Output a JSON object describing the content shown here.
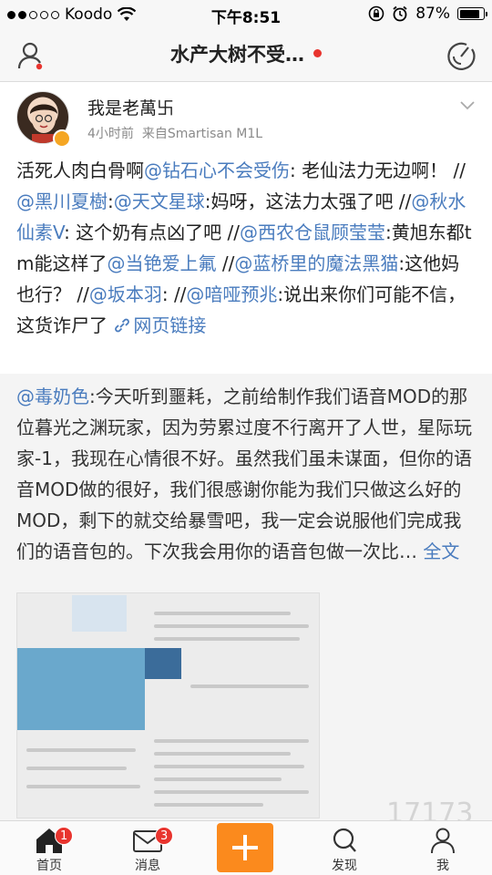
{
  "status_bar": {
    "carrier": "Koodo",
    "time": "下午8:51",
    "battery": "87%",
    "battery_level": 0.87
  },
  "nav": {
    "title": "水产大树不受…"
  },
  "post": {
    "author": "我是老萬卐",
    "time": "4小时前",
    "source": "来自Smartisan M1L",
    "text_segments": [
      {
        "t": "活死人肉白骨啊",
        "m": false
      },
      {
        "t": "@钻石心不会受伤",
        "m": true
      },
      {
        "t": ": 老仙法力无边啊！ //",
        "m": false
      },
      {
        "t": "@黑川夏樹",
        "m": true
      },
      {
        "t": ":",
        "m": false
      },
      {
        "t": "@天文星球",
        "m": true
      },
      {
        "t": ":妈呀，这法力太强了吧 //",
        "m": false
      },
      {
        "t": "@秋水仙素V",
        "m": true
      },
      {
        "t": ": 这个奶有点凶了吧 //",
        "m": false
      },
      {
        "t": "@西农仓鼠顾莹莹",
        "m": true
      },
      {
        "t": ":黄旭东都tm能这样了",
        "m": false
      },
      {
        "t": "@当铯爱上氟",
        "m": true
      },
      {
        "t": " //",
        "m": false
      },
      {
        "t": "@蓝桥里的魔法黑猫",
        "m": true
      },
      {
        "t": ":这他妈也行？ //",
        "m": false
      },
      {
        "t": "@坂本羽",
        "m": true
      },
      {
        "t": ": //",
        "m": false
      },
      {
        "t": "@喑哑预兆",
        "m": true
      },
      {
        "t": ":说出来你们可能不信，这货诈尸了 ",
        "m": false
      }
    ],
    "link_label": "网页链接"
  },
  "repost": {
    "mention": "@毒奶色",
    "text": ":今天听到噩耗，之前给制作我们语音MOD的那位暮光之渊玩家，因为劳累过度不行离开了人世，星际玩家-1，我现在心情很不好。虽然我们虽未谋面，但你的语音MOD做的很好，我们很感谢你能为我们只做这么好的MOD，剩下的就交给暴雪吧，我一定会说服他们完成我们的语音包的。下次我会用你的语音包做一次比… ",
    "full_text_label": "全文"
  },
  "tabs": [
    {
      "label": "首页",
      "badge": "1"
    },
    {
      "label": "消息",
      "badge": "3"
    },
    {
      "label": "发现",
      "badge": ""
    },
    {
      "label": "我",
      "badge": ""
    }
  ],
  "colors": {
    "mention": "#4a7cbe",
    "compose": "#fb8a1d",
    "badge": "#e8342e"
  }
}
